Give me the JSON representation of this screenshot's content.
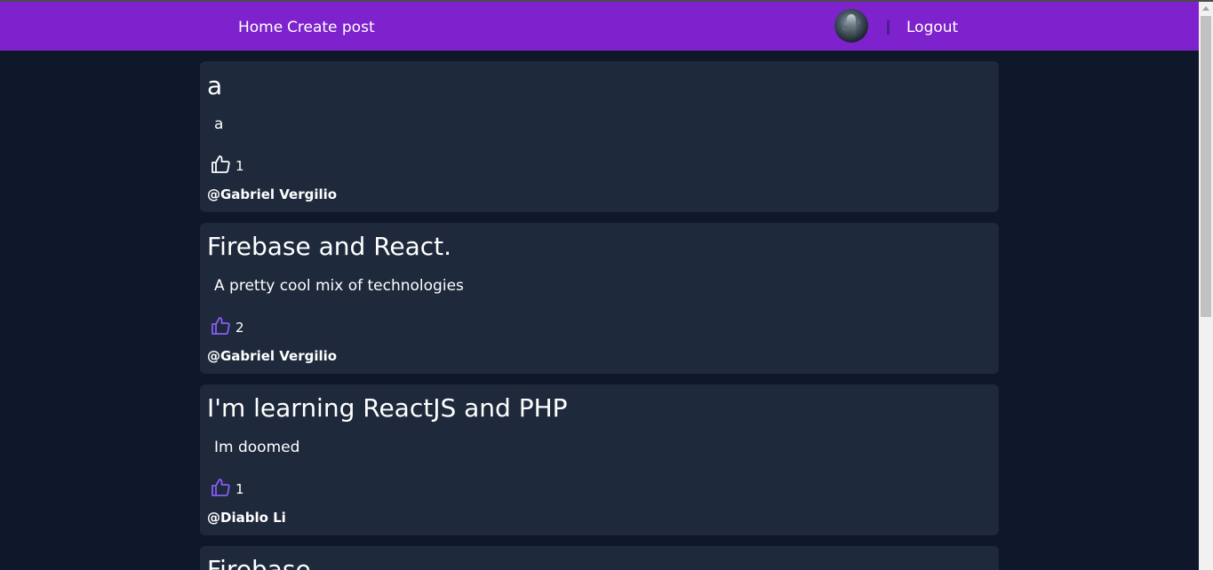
{
  "nav": {
    "home": "Home",
    "create_post": "Create post",
    "logout": "Logout"
  },
  "colors": {
    "nav_bg": "#7e22ce",
    "page_bg": "#0f172a",
    "card_bg": "#1e293b",
    "liked_icon": "#8b5cf6",
    "unliked_icon": "#ffffff"
  },
  "posts": [
    {
      "title": "a",
      "body": "a",
      "likes": "1",
      "liked": false,
      "author": "@Gabriel Vergilio"
    },
    {
      "title": "Firebase and React.",
      "body": "A pretty cool mix of technologies",
      "likes": "2",
      "liked": true,
      "author": "@Gabriel Vergilio"
    },
    {
      "title": "I'm learning ReactJS and PHP",
      "body": "Im doomed",
      "likes": "1",
      "liked": true,
      "author": "@Diablo Li"
    },
    {
      "title": "Firebase",
      "body": "",
      "likes": "",
      "liked": false,
      "author": ""
    }
  ]
}
